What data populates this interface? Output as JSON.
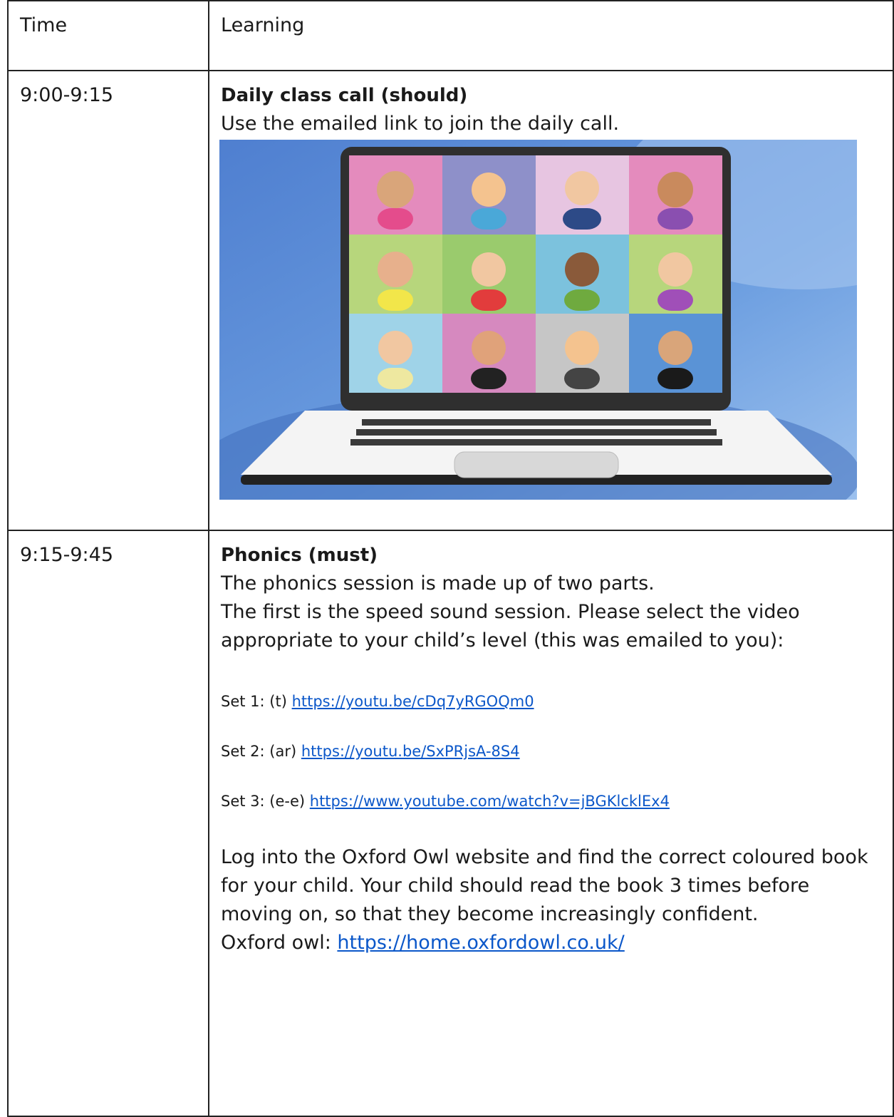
{
  "header": {
    "time_label": "Time",
    "learning_label": "Learning"
  },
  "rows": [
    {
      "time": "9:00-9:15",
      "title": "Daily class call (should)",
      "text": "Use the emailed link to join the daily call."
    },
    {
      "time": "9:15-9:45",
      "title": "Phonics (must)",
      "p1": "The phonics session is made up of two parts.",
      "p2a": "The first is the speed sound session. Please select the video",
      "p2b": "appropriate to your child’s level (this was emailed to you):",
      "sets": [
        {
          "label": "Set 1: (t)",
          "url": "https://youtu.be/cDq7yRGOQm0"
        },
        {
          "label": "Set 2: (ar)",
          "url": "https://youtu.be/SxPRjsA-8S4"
        },
        {
          "label": "Set 3: (e-e)",
          "url": "https://www.youtube.com/watch?v=jBGKlcklEx4"
        }
      ],
      "oxford_text": "Log into the Oxford Owl website and find the correct coloured book for your child. Your child should read the book 3 times before moving on, so that they become increasingly confident.",
      "oxford_label": "Oxford owl:",
      "oxford_url": "https://home.oxfordowl.co.uk/"
    }
  ],
  "colors": {
    "link": "#0b57c9",
    "image_bg": "#5b8fd6",
    "laptop_frame": "#2f2f2f"
  },
  "image": {
    "icon": "video-call-laptop-illustration"
  }
}
